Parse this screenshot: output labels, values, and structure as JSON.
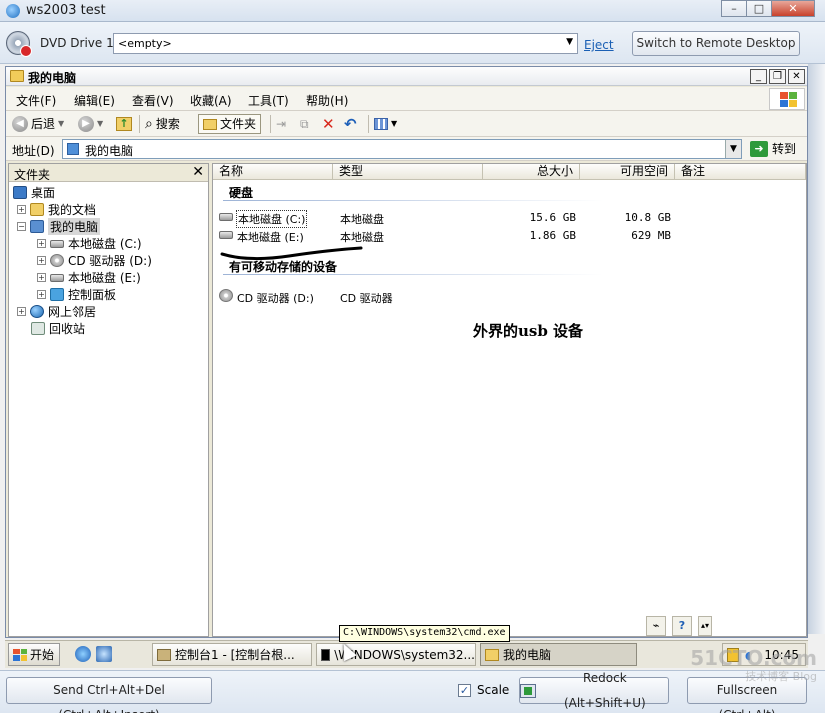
{
  "window": {
    "title": "ws2003 test"
  },
  "vm_toolbar": {
    "dvd_label": "DVD Drive 1:",
    "dvd_value": "<empty>",
    "eject": "Eject",
    "switch_remote": "Switch to Remote Desktop"
  },
  "explorer": {
    "title": "我的电脑",
    "menu": [
      "文件(F)",
      "编辑(E)",
      "查看(V)",
      "收藏(A)",
      "工具(T)",
      "帮助(H)"
    ],
    "toolbar": {
      "back": "后退",
      "search": "搜索",
      "folders": "文件夹"
    },
    "address": {
      "label": "地址(D)",
      "value": "我的电脑",
      "go": "转到"
    },
    "folder_pane": {
      "title": "文件夹",
      "tree": [
        {
          "label": "桌面",
          "icon": "desktop-icon",
          "level": 0
        },
        {
          "label": "我的文档",
          "icon": "folder-icon",
          "level": 1
        },
        {
          "label": "我的电脑",
          "icon": "computer-icon",
          "level": 1
        },
        {
          "label": "本地磁盘 (C:)",
          "icon": "disk-icon",
          "level": 2
        },
        {
          "label": "CD 驱动器 (D:)",
          "icon": "cd-icon",
          "level": 2
        },
        {
          "label": "本地磁盘 (E:)",
          "icon": "disk-icon",
          "level": 2
        },
        {
          "label": "控制面板",
          "icon": "control-panel-icon",
          "level": 2
        },
        {
          "label": "网上邻居",
          "icon": "network-icon",
          "level": 1
        },
        {
          "label": "回收站",
          "icon": "recycle-bin-icon",
          "level": 1
        }
      ]
    },
    "list": {
      "columns": [
        "名称",
        "类型",
        "总大小",
        "可用空间",
        "备注"
      ],
      "groups": [
        {
          "title": "硬盘",
          "items": [
            {
              "name": "本地磁盘 (C:)",
              "type": "本地磁盘",
              "total": "15.6 GB",
              "free": "10.8 GB"
            },
            {
              "name": "本地磁盘 (E:)",
              "type": "本地磁盘",
              "total": "1.86 GB",
              "free": "629 MB"
            }
          ]
        },
        {
          "title": "有可移动存储的设备",
          "items": [
            {
              "name": "CD 驱动器 (D:)",
              "type": "CD 驱动器",
              "total": "",
              "free": ""
            }
          ]
        }
      ],
      "annotation": "外界的usb 设备"
    }
  },
  "taskbar": {
    "start": "开始",
    "tasks": [
      "控制台1 - [控制台根...",
      "\\WINDOWS\\system32...",
      "我的电脑"
    ],
    "clock": "10:45",
    "tooltip": "C:\\WINDOWS\\system32\\cmd.exe"
  },
  "host_bar": {
    "ctrl_alt_del": "Send Ctrl+Alt+Del (Ctrl+Alt+Insert)",
    "scale": "Scale",
    "redock": "Redock (Alt+Shift+U)",
    "fullscreen": "Fullscreen (Ctrl+Alt)"
  },
  "watermark": {
    "main": "51CTO.com",
    "sub": "技术博客 Blog"
  }
}
